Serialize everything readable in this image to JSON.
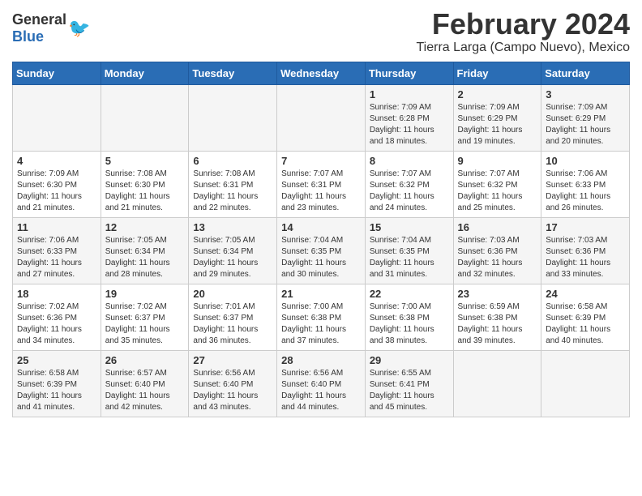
{
  "header": {
    "logo_general": "General",
    "logo_blue": "Blue",
    "main_title": "February 2024",
    "subtitle": "Tierra Larga (Campo Nuevo), Mexico"
  },
  "calendar": {
    "days_of_week": [
      "Sunday",
      "Monday",
      "Tuesday",
      "Wednesday",
      "Thursday",
      "Friday",
      "Saturday"
    ],
    "weeks": [
      [
        {
          "day": "",
          "info": ""
        },
        {
          "day": "",
          "info": ""
        },
        {
          "day": "",
          "info": ""
        },
        {
          "day": "",
          "info": ""
        },
        {
          "day": "1",
          "info": "Sunrise: 7:09 AM\nSunset: 6:28 PM\nDaylight: 11 hours and 18 minutes."
        },
        {
          "day": "2",
          "info": "Sunrise: 7:09 AM\nSunset: 6:29 PM\nDaylight: 11 hours and 19 minutes."
        },
        {
          "day": "3",
          "info": "Sunrise: 7:09 AM\nSunset: 6:29 PM\nDaylight: 11 hours and 20 minutes."
        }
      ],
      [
        {
          "day": "4",
          "info": "Sunrise: 7:09 AM\nSunset: 6:30 PM\nDaylight: 11 hours and 21 minutes."
        },
        {
          "day": "5",
          "info": "Sunrise: 7:08 AM\nSunset: 6:30 PM\nDaylight: 11 hours and 21 minutes."
        },
        {
          "day": "6",
          "info": "Sunrise: 7:08 AM\nSunset: 6:31 PM\nDaylight: 11 hours and 22 minutes."
        },
        {
          "day": "7",
          "info": "Sunrise: 7:07 AM\nSunset: 6:31 PM\nDaylight: 11 hours and 23 minutes."
        },
        {
          "day": "8",
          "info": "Sunrise: 7:07 AM\nSunset: 6:32 PM\nDaylight: 11 hours and 24 minutes."
        },
        {
          "day": "9",
          "info": "Sunrise: 7:07 AM\nSunset: 6:32 PM\nDaylight: 11 hours and 25 minutes."
        },
        {
          "day": "10",
          "info": "Sunrise: 7:06 AM\nSunset: 6:33 PM\nDaylight: 11 hours and 26 minutes."
        }
      ],
      [
        {
          "day": "11",
          "info": "Sunrise: 7:06 AM\nSunset: 6:33 PM\nDaylight: 11 hours and 27 minutes."
        },
        {
          "day": "12",
          "info": "Sunrise: 7:05 AM\nSunset: 6:34 PM\nDaylight: 11 hours and 28 minutes."
        },
        {
          "day": "13",
          "info": "Sunrise: 7:05 AM\nSunset: 6:34 PM\nDaylight: 11 hours and 29 minutes."
        },
        {
          "day": "14",
          "info": "Sunrise: 7:04 AM\nSunset: 6:35 PM\nDaylight: 11 hours and 30 minutes."
        },
        {
          "day": "15",
          "info": "Sunrise: 7:04 AM\nSunset: 6:35 PM\nDaylight: 11 hours and 31 minutes."
        },
        {
          "day": "16",
          "info": "Sunrise: 7:03 AM\nSunset: 6:36 PM\nDaylight: 11 hours and 32 minutes."
        },
        {
          "day": "17",
          "info": "Sunrise: 7:03 AM\nSunset: 6:36 PM\nDaylight: 11 hours and 33 minutes."
        }
      ],
      [
        {
          "day": "18",
          "info": "Sunrise: 7:02 AM\nSunset: 6:36 PM\nDaylight: 11 hours and 34 minutes."
        },
        {
          "day": "19",
          "info": "Sunrise: 7:02 AM\nSunset: 6:37 PM\nDaylight: 11 hours and 35 minutes."
        },
        {
          "day": "20",
          "info": "Sunrise: 7:01 AM\nSunset: 6:37 PM\nDaylight: 11 hours and 36 minutes."
        },
        {
          "day": "21",
          "info": "Sunrise: 7:00 AM\nSunset: 6:38 PM\nDaylight: 11 hours and 37 minutes."
        },
        {
          "day": "22",
          "info": "Sunrise: 7:00 AM\nSunset: 6:38 PM\nDaylight: 11 hours and 38 minutes."
        },
        {
          "day": "23",
          "info": "Sunrise: 6:59 AM\nSunset: 6:38 PM\nDaylight: 11 hours and 39 minutes."
        },
        {
          "day": "24",
          "info": "Sunrise: 6:58 AM\nSunset: 6:39 PM\nDaylight: 11 hours and 40 minutes."
        }
      ],
      [
        {
          "day": "25",
          "info": "Sunrise: 6:58 AM\nSunset: 6:39 PM\nDaylight: 11 hours and 41 minutes."
        },
        {
          "day": "26",
          "info": "Sunrise: 6:57 AM\nSunset: 6:40 PM\nDaylight: 11 hours and 42 minutes."
        },
        {
          "day": "27",
          "info": "Sunrise: 6:56 AM\nSunset: 6:40 PM\nDaylight: 11 hours and 43 minutes."
        },
        {
          "day": "28",
          "info": "Sunrise: 6:56 AM\nSunset: 6:40 PM\nDaylight: 11 hours and 44 minutes."
        },
        {
          "day": "29",
          "info": "Sunrise: 6:55 AM\nSunset: 6:41 PM\nDaylight: 11 hours and 45 minutes."
        },
        {
          "day": "",
          "info": ""
        },
        {
          "day": "",
          "info": ""
        }
      ]
    ]
  }
}
